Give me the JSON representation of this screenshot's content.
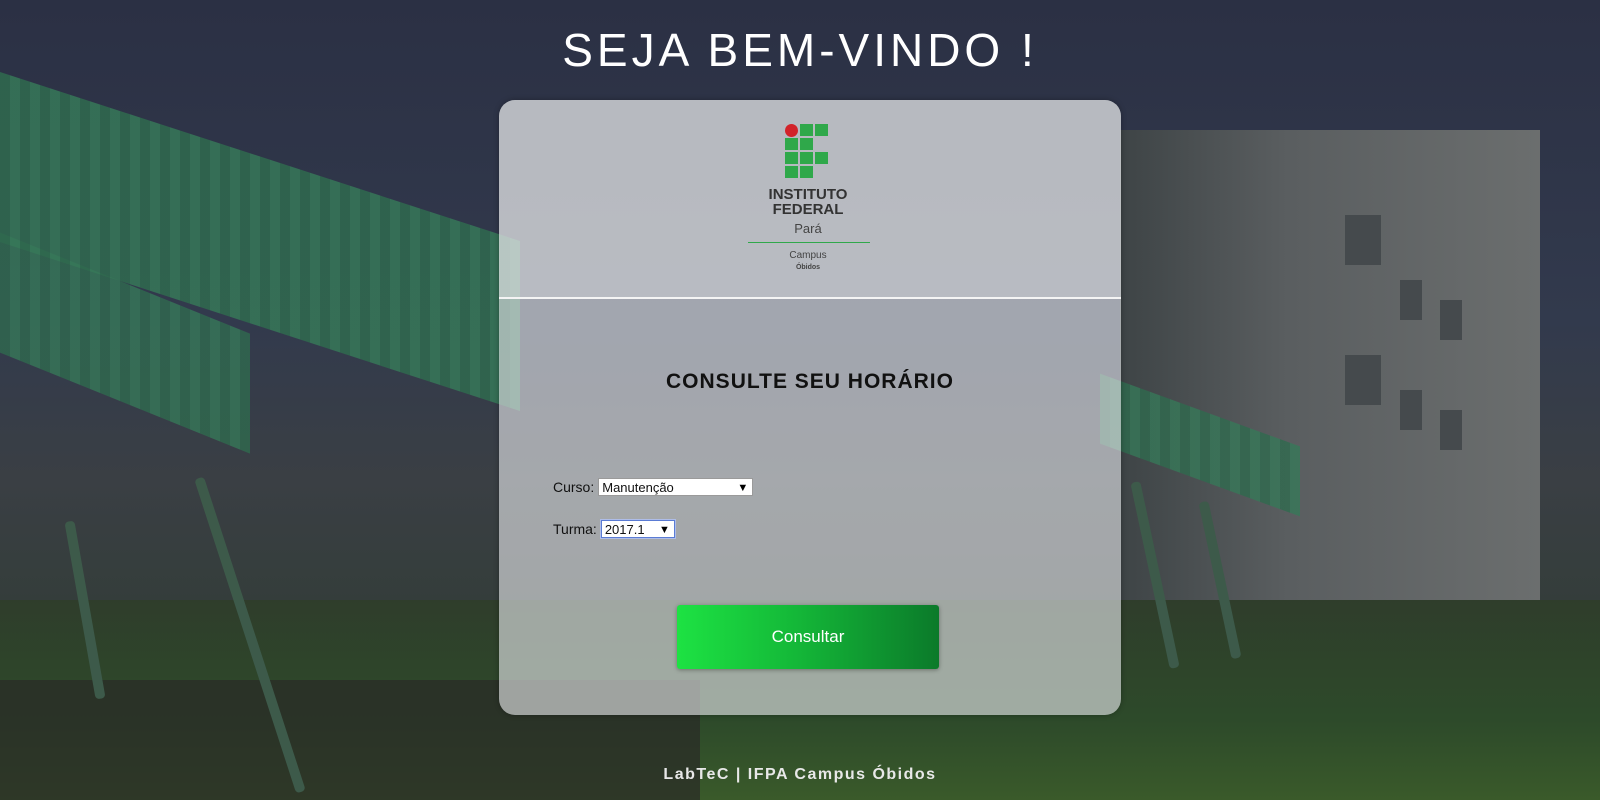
{
  "header": {
    "welcome_title": "SEJA BEM-VINDO !"
  },
  "logo": {
    "name_line1": "INSTITUTO",
    "name_line2": "FEDERAL",
    "state": "Pará",
    "campus_label": "Campus",
    "campus_name": "Óbidos",
    "colors": {
      "green": "#2fa84a",
      "red": "#d2232a"
    }
  },
  "form": {
    "title": "CONSULTE SEU HORÁRIO",
    "course": {
      "label": "Curso:",
      "selected": "Manutenção"
    },
    "class": {
      "label": "Turma:",
      "selected": "2017.1"
    },
    "submit_label": "Consultar",
    "submit_color": "#14b838"
  },
  "footer": {
    "text": "LabTeC | IFPA Campus Óbidos"
  }
}
